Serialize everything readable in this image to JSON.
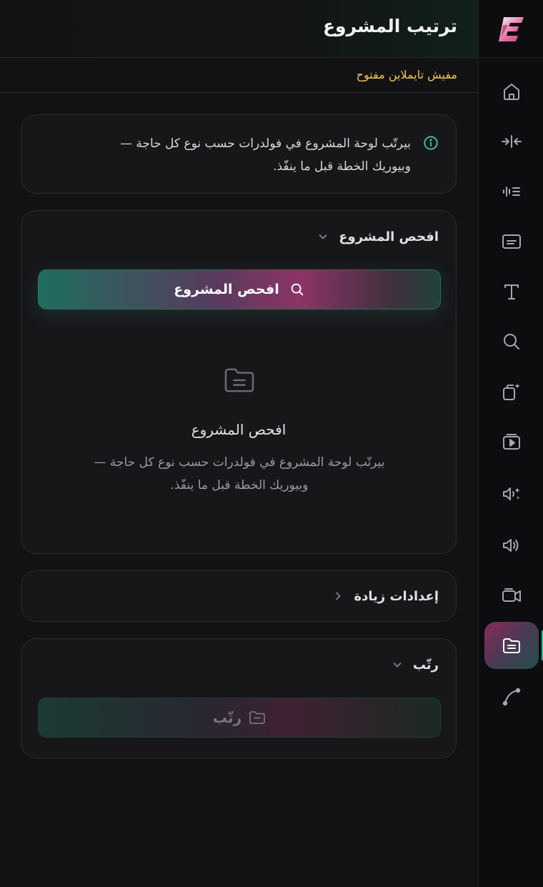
{
  "header": {
    "title": "ترتيب المشروع"
  },
  "status": {
    "text": "مفيش تايملاين مفتوح"
  },
  "info": {
    "line1": "بيرتّب لوحة المشروع في فولدرات حسب نوع كل حاجة —",
    "line2": "وبيوريك الخطة قبل ما ينفّذ."
  },
  "scan_section": {
    "label": "افحص المشروع",
    "button_label": "افحص المشروع",
    "empty_title": "افحص المشروع",
    "empty_line1": "بيرتّب لوحة المشروع في فولدرات حسب نوع كل حاجة —",
    "empty_line2": "وبيوريك الخطة قبل ما ينفّذ."
  },
  "more_settings": {
    "label": "إعدادات زيادة"
  },
  "arrange_section": {
    "label": "رتّب",
    "button_label": "رتّب"
  },
  "colors": {
    "accent_green": "#2fc39a",
    "accent_pink": "#c2407e",
    "status_yellow": "#f0c75e"
  },
  "rail": {
    "items": [
      {
        "icon": "home-icon"
      },
      {
        "icon": "split-icon"
      },
      {
        "icon": "audio-levels-icon"
      },
      {
        "icon": "subtitles-icon"
      },
      {
        "icon": "text-icon"
      },
      {
        "icon": "search-icon"
      },
      {
        "icon": "ai-effects-icon"
      },
      {
        "icon": "media-library-icon"
      },
      {
        "icon": "ai-voice-icon"
      },
      {
        "icon": "volume-icon"
      },
      {
        "icon": "video-camera-icon"
      },
      {
        "icon": "folder-organize-icon",
        "active": true
      },
      {
        "icon": "curve-icon"
      }
    ]
  }
}
